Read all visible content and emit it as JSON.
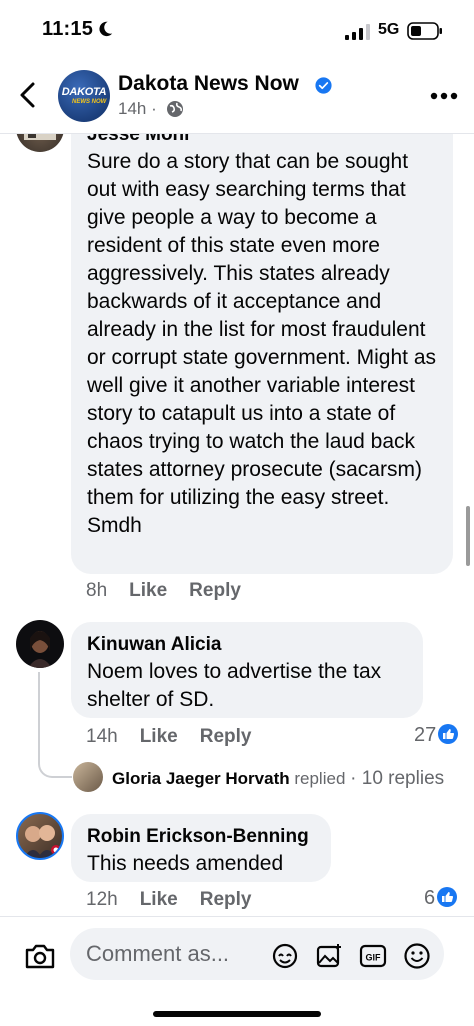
{
  "status_bar": {
    "time": "11:15",
    "network": "5G"
  },
  "header": {
    "page_name": "Dakota News Now",
    "time_ago": "14h",
    "dot": "·",
    "logo_top": "DAKOTA",
    "logo_bottom": "NEWS NOW"
  },
  "comments": [
    {
      "author": "Jesse Mohr",
      "text": "Sure do a story that can be sought out with easy searching terms that give people a way to become a resident of this state even more aggressively. This states already backwards of it acceptance and already in the list for most fraudulent or corrupt state government. Might as well give it another variable interest story to catapult us into a state of chaos trying to watch the laud back states attorney prosecute (sacarsm) them for utilizing the easy street. Smdh",
      "time": "8h",
      "like_label": "Like",
      "reply_label": "Reply"
    },
    {
      "author": "Kinuwan Alicia",
      "text": "Noem loves to advertise the tax shelter of SD.",
      "time": "14h",
      "like_label": "Like",
      "reply_label": "Reply",
      "reaction_count": "27",
      "replies": {
        "replier": "Gloria Jaeger Horvath",
        "replied_word": "replied",
        "count_text": "· 10 replies"
      }
    },
    {
      "author": "Robin Erickson-Benning",
      "text": "This needs amended",
      "time": "12h",
      "like_label": "Like",
      "reply_label": "Reply",
      "reaction_count": "6"
    }
  ],
  "composer": {
    "placeholder": "Comment as..."
  },
  "colors": {
    "accent": "#1877f2",
    "bubble": "#f0f2f5",
    "muted": "#65676b"
  },
  "icons": [
    "back-icon",
    "verified-icon",
    "globe-icon",
    "more-icon",
    "like-icon",
    "camera-icon",
    "avatar-sticker-icon",
    "gallery-icon",
    "gif-icon",
    "emoji-icon"
  ]
}
